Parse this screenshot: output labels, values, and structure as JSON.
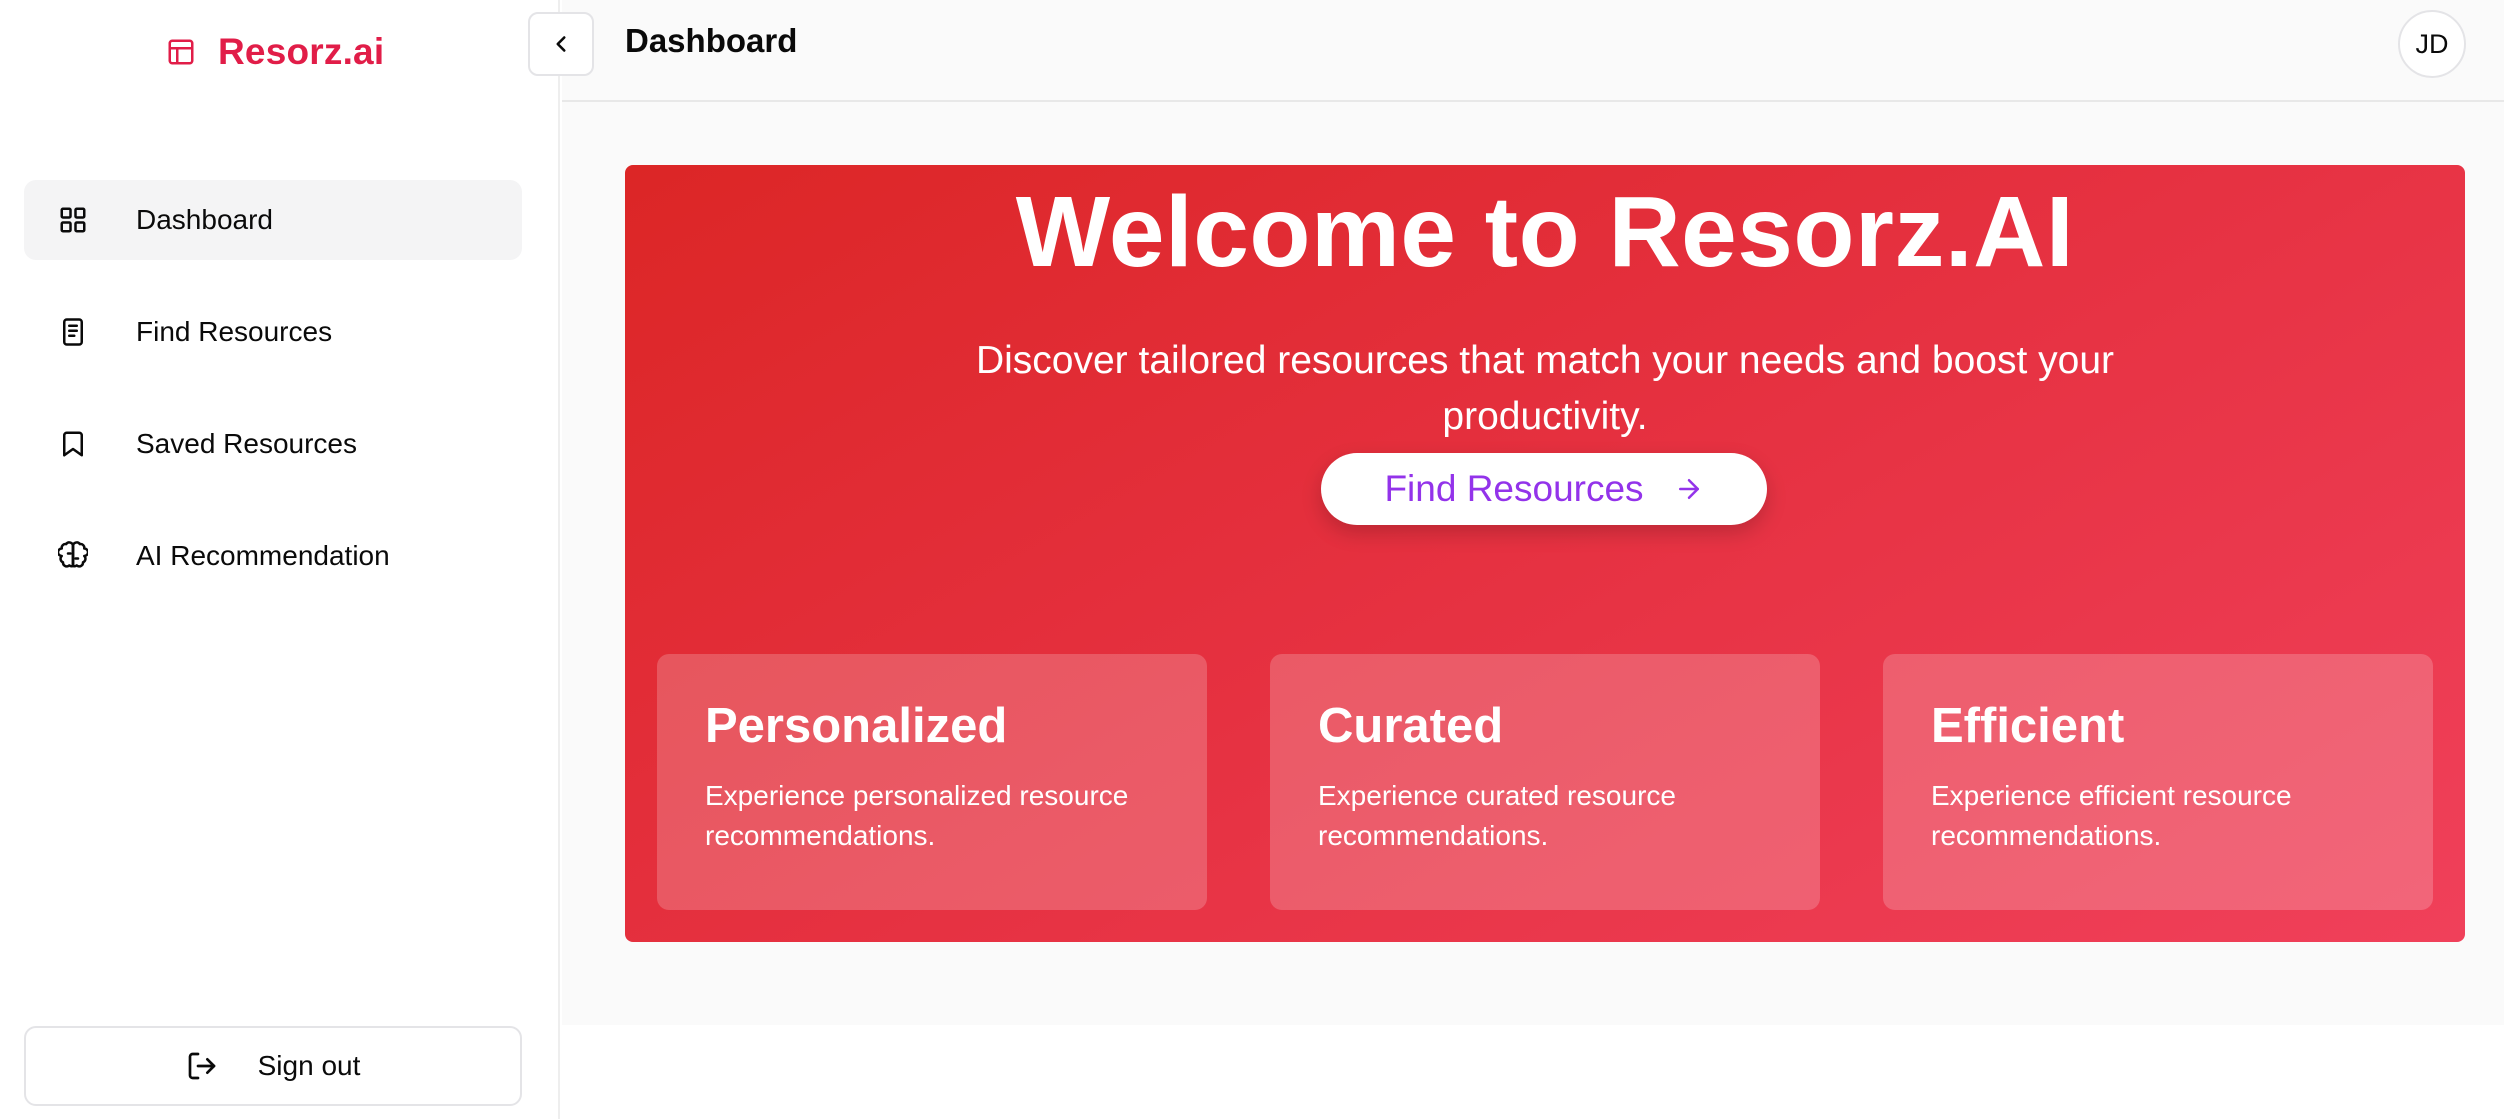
{
  "brand": {
    "name": "Resorz.ai",
    "icon": "layout-icon",
    "color": "#e11d48"
  },
  "sidebar": {
    "items": [
      {
        "label": "Dashboard",
        "icon": "grid-icon",
        "active": true
      },
      {
        "label": "Find Resources",
        "icon": "book-icon",
        "active": false
      },
      {
        "label": "Saved Resources",
        "icon": "bookmark-icon",
        "active": false
      },
      {
        "label": "AI Recommendation",
        "icon": "brain-icon",
        "active": false
      }
    ],
    "signout_label": "Sign out",
    "signout_icon": "log-out-icon"
  },
  "header": {
    "title": "Dashboard",
    "avatar_initials": "JD",
    "collapse_icon": "chevron-left-icon"
  },
  "hero": {
    "title": "Welcome to Resorz.AI",
    "subtitle": "Discover tailored resources that match your needs and boost your productivity.",
    "cta_label": "Find Resources",
    "cta_icon": "arrow-right-icon",
    "cta_color": "#9333ea",
    "gradient": [
      "#dc2626",
      "#f0405a"
    ]
  },
  "features": [
    {
      "title": "Personalized",
      "description": "Experience personalized resource recommendations."
    },
    {
      "title": "Curated",
      "description": "Experience curated resource recommendations."
    },
    {
      "title": "Efficient",
      "description": "Experience efficient resource recommendations."
    }
  ]
}
